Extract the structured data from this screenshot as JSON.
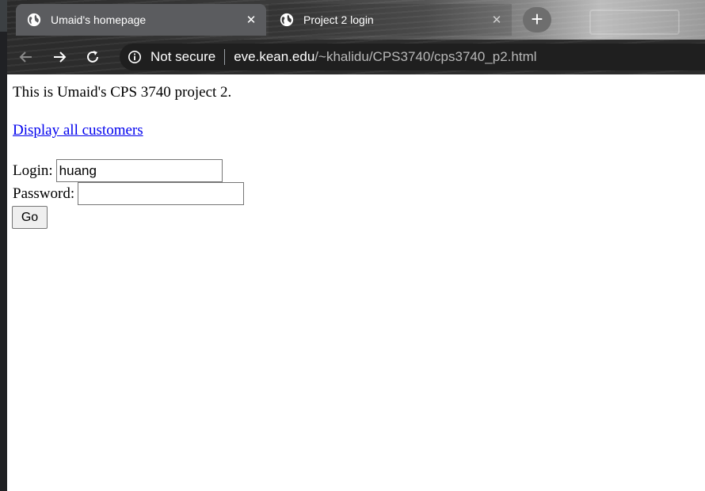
{
  "tabs": [
    {
      "title": "Umaid's homepage",
      "active": true,
      "icon": "globe-icon",
      "close": "✕"
    },
    {
      "title": "Project 2 login",
      "active": false,
      "icon": "globe-icon",
      "close": "✕"
    }
  ],
  "new_tab_label": "+",
  "address_bar": {
    "security_label": "Not secure",
    "url_host": "eve.kean.edu",
    "url_path": "/~khalidu/CPS3740/cps3740_p2.html"
  },
  "page": {
    "intro": "This is Umaid's CPS 3740 project 2.",
    "link_text": "Display all customers",
    "login_label": "Login:",
    "login_value": "huang",
    "password_label": "Password:",
    "password_value": "",
    "go_label": "Go"
  },
  "colors": {
    "link": "#0000ee",
    "active_tab": "#5b5c5f",
    "accent": "#1a73e8"
  }
}
